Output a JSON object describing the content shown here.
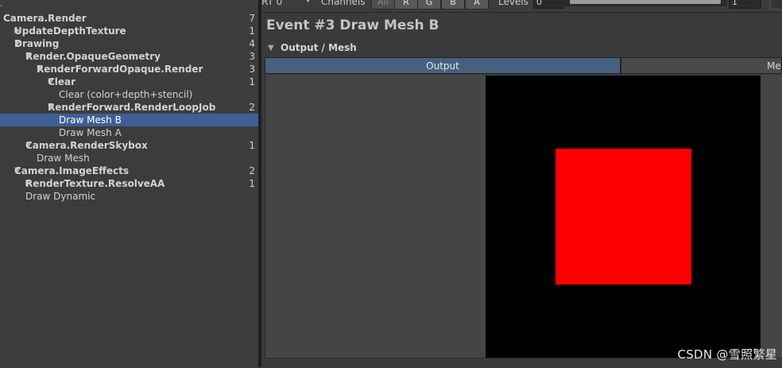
{
  "event_tree": [
    {
      "label": "Camera.Render",
      "count": "7",
      "bold": true,
      "arrow": ""
    },
    {
      "label": "UpdateDepthTexture",
      "count": "1",
      "bold": true,
      "arrow": "▶"
    },
    {
      "label": "Drawing",
      "count": "4",
      "bold": true,
      "arrow": "▼"
    },
    {
      "label": "Render.OpaqueGeometry",
      "count": "3",
      "bold": true,
      "arrow": "▼"
    },
    {
      "label": "RenderForwardOpaque.Render",
      "count": "3",
      "bold": true,
      "arrow": "▼"
    },
    {
      "label": "Clear",
      "count": "1",
      "bold": true,
      "arrow": "▼"
    },
    {
      "label": "Clear (color+depth+stencil)",
      "count": "",
      "bold": false,
      "arrow": ""
    },
    {
      "label": "RenderForward.RenderLoopJob",
      "count": "2",
      "bold": true,
      "arrow": "▼"
    },
    {
      "label": "Draw Mesh B",
      "count": "",
      "bold": false,
      "arrow": "",
      "selected": true
    },
    {
      "label": "Draw Mesh A",
      "count": "",
      "bold": false,
      "arrow": ""
    },
    {
      "label": "Camera.RenderSkybox",
      "count": "1",
      "bold": true,
      "arrow": "▼"
    },
    {
      "label": "Draw Mesh",
      "count": "",
      "bold": false,
      "arrow": ""
    },
    {
      "label": "Camera.ImageEffects",
      "count": "2",
      "bold": true,
      "arrow": "▼"
    },
    {
      "label": "RenderTexture.ResolveAA",
      "count": "1",
      "bold": true,
      "arrow": "▶"
    },
    {
      "label": "Draw Dynamic",
      "count": "",
      "bold": false,
      "arrow": ""
    }
  ],
  "toolbar": {
    "rt_value": "RT 0",
    "channels_label": "Channels",
    "channel_buttons": [
      "All",
      "R",
      "G",
      "B",
      "A"
    ],
    "levels_label": "Levels",
    "levels_min": "0",
    "levels_max": "1"
  },
  "event_title": "Event #3 Draw Mesh B",
  "section": {
    "label": "Output / Mesh"
  },
  "tabs": {
    "output": "Output",
    "mesh": "Me"
  },
  "preview": {
    "background_color": "#000000",
    "mesh_color": "#ff0000"
  },
  "watermark": "CSDN @雪照繁星",
  "icons": {
    "expand": "triangle-right-icon",
    "collapse": "triangle-down-icon",
    "dropdown": "dropdown-arrow-icon"
  }
}
